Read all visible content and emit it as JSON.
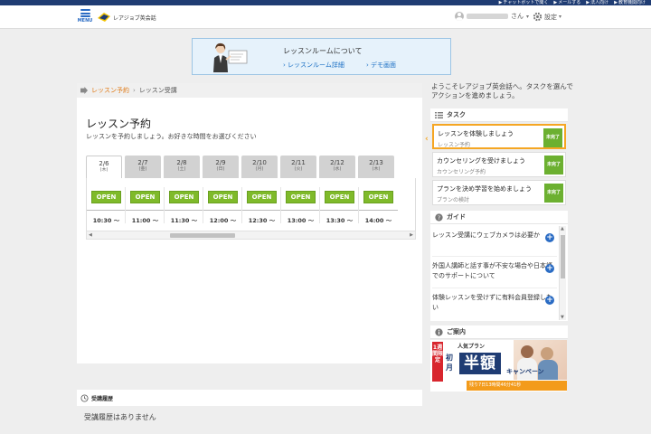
{
  "top_links": {
    "chatbot": "チャットボットで聞く",
    "mail": "メールする",
    "corporate": "法人向け",
    "education": "教育機関向け"
  },
  "header": {
    "menu_label": "MENU",
    "logo_text": "レアジョブ英会話",
    "user_suffix": "さん",
    "settings_label": "設定"
  },
  "banner": {
    "title": "レッスンルームについて",
    "link1": "› レッスンルーム詳細",
    "link2": "› デモ画面"
  },
  "breadcrumb": {
    "active": "レッスン予約",
    "separator": "›",
    "current": "レッスン受講"
  },
  "main": {
    "title": "レッスン予約",
    "subtitle": "レッスンを予約しましょう。お好きな時間をお選びください"
  },
  "schedule": {
    "days": [
      {
        "date": "2/6",
        "weekday": "(木)"
      },
      {
        "date": "2/7",
        "weekday": "(金)"
      },
      {
        "date": "2/8",
        "weekday": "(土)"
      },
      {
        "date": "2/9",
        "weekday": "(日)"
      },
      {
        "date": "2/10",
        "weekday": "(月)"
      },
      {
        "date": "2/11",
        "weekday": "(火)"
      },
      {
        "date": "2/12",
        "weekday": "(水)"
      },
      {
        "date": "2/13",
        "weekday": "(木)"
      }
    ],
    "slots": [
      {
        "button": "OPEN",
        "time": "10:30 〜"
      },
      {
        "button": "OPEN",
        "time": "11:00 〜"
      },
      {
        "button": "OPEN",
        "time": "11:30 〜"
      },
      {
        "button": "OPEN",
        "time": "12:00 〜"
      },
      {
        "button": "OPEN",
        "time": "12:30 〜"
      },
      {
        "button": "OPEN",
        "time": "13:00 〜"
      },
      {
        "button": "OPEN",
        "time": "13:30 〜"
      },
      {
        "button": "OPEN",
        "time": "14:00 〜"
      }
    ]
  },
  "history": {
    "label": "受講履歴",
    "empty": "受講履歴はありません"
  },
  "sidebar": {
    "welcome": "ようこそレアジョブ英会話へ。タスクを選んでアクションを進めましょう。",
    "task_header": "タスク",
    "tasks": [
      {
        "title": "レッスンを体験しましょう",
        "sub": "レッスン予約",
        "badge": "未完了"
      },
      {
        "title": "カウンセリングを受けましょう",
        "sub": "カウンセリング予約",
        "badge": "未完了"
      },
      {
        "title": "プランを決め学習を始めましょう",
        "sub": "プランの検討",
        "badge": "未完了"
      }
    ],
    "guide_header": "ガイド",
    "guides": [
      {
        "text": "レッスン受講にウェブカメラは必要か"
      },
      {
        "text": "外国人講師と話す事が不安な場合や日本語でのサポートについて"
      },
      {
        "text": "体験レッスンを受けずに有料会員登録したい"
      }
    ],
    "info_header": "ご案内"
  },
  "promo": {
    "tag": "1週間限定",
    "popular": "人気プラン",
    "first_month": "初月",
    "half": "半額",
    "campaign": "キャンペーン",
    "countdown": "残り7日13時間46分41秒"
  },
  "colors": {
    "brand_navy": "#1f3c73",
    "open_green": "#7fba2a",
    "task_orange": "#f5a623",
    "link_blue": "#1a6fc4",
    "promo_red": "#d8262e"
  }
}
